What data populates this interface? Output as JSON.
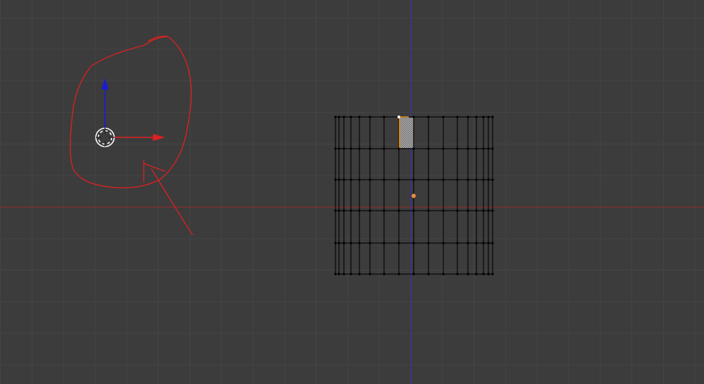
{
  "viewport": {
    "view": "front-orthographic",
    "background_color": "#3c3c3c",
    "grid_color": "#454545",
    "x_axis_color": "#9b2a2a",
    "z_axis_color": "#3030c8"
  },
  "mesh": {
    "type": "grid",
    "columns": 17,
    "rows": 6,
    "edge_color": "#0a0a0a",
    "vertex_color": "#000000",
    "selected_face": {
      "column": 7,
      "row": 0,
      "color": "#b8b8b8"
    },
    "selected_edge_color": "#ff9a20",
    "active_vertex_color": "#ffffff",
    "origin_color": "#e8914a"
  },
  "gizmo": {
    "icons": [
      "3d-cursor-icon",
      "z-arrow-icon",
      "x-arrow-icon"
    ],
    "z_arrow_color": "#1a1ad8",
    "x_arrow_color": "#e02020"
  },
  "annotation": {
    "color": "#e02020",
    "shapes": [
      "hand-drawn-circle",
      "hand-drawn-arrow"
    ]
  }
}
